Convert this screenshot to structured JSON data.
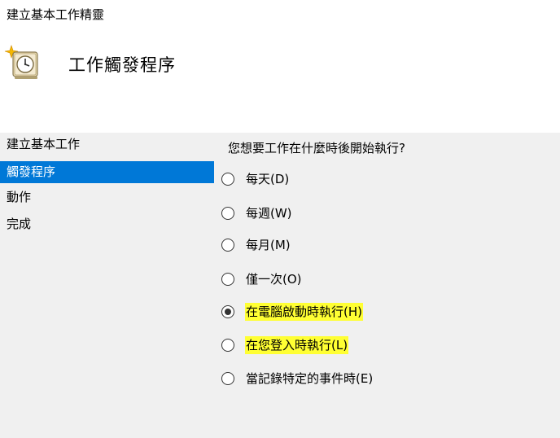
{
  "window": {
    "title": "建立基本工作精靈"
  },
  "header": {
    "icon": "task-clock-icon",
    "title": "工作觸發程序"
  },
  "nav": {
    "items": [
      {
        "label": "建立基本工作",
        "selected": false
      },
      {
        "label": "觸發程序",
        "selected": true
      },
      {
        "label": "動作",
        "selected": false
      },
      {
        "label": "完成",
        "selected": false
      }
    ],
    "selected_color": "#0078d7"
  },
  "main": {
    "question": "您想要工作在什麼時後開始執行?",
    "options": [
      {
        "label": "每天(D)",
        "checked": false,
        "highlighted": false
      },
      {
        "label": "每週(W)",
        "checked": false,
        "highlighted": false
      },
      {
        "label": "每月(M)",
        "checked": false,
        "highlighted": false
      },
      {
        "label": "僅一次(O)",
        "checked": false,
        "highlighted": false
      },
      {
        "label": "在電腦啟動時執行(H)",
        "checked": true,
        "highlighted": true
      },
      {
        "label": "在您登入時執行(L)",
        "checked": false,
        "highlighted": true
      },
      {
        "label": "當記錄特定的事件時(E)",
        "checked": false,
        "highlighted": false
      }
    ],
    "highlight_color": "#ffff33"
  }
}
